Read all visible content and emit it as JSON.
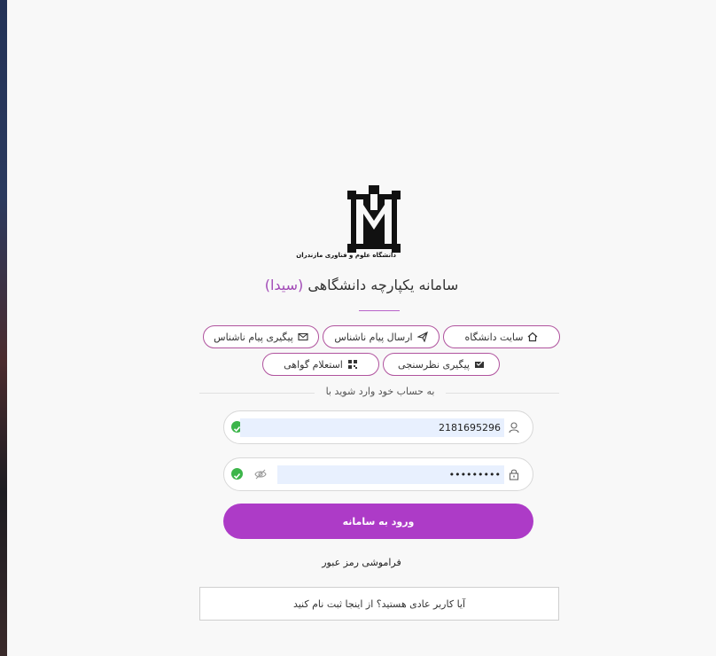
{
  "brand": {
    "logo_caption": "دانشگاه علوم و فناوری مازندران",
    "title_main": "سامانه یکپارچه دانشگاهی",
    "title_accent": "(سیدا)",
    "accent_color": "#a24bb7",
    "button_color": "#ad3bc7"
  },
  "quick_links": [
    {
      "label": "سایت دانشگاه",
      "icon": "home-icon"
    },
    {
      "label": "ارسال پیام ناشناس",
      "icon": "send-icon"
    },
    {
      "label": "پیگیری پیام ناشناس",
      "icon": "envelope-icon"
    },
    {
      "label": "پیگیری نظرسنجی",
      "icon": "inbox-icon"
    },
    {
      "label": "استعلام گواهی",
      "icon": "qr-icon"
    }
  ],
  "login": {
    "divider_text": "به حساب خود وارد شوید با",
    "username_value": "2181695296",
    "password_value": "•••••••••",
    "submit_label": "ورود به سامانه",
    "forgot_label": "فراموشی رمز عبور",
    "register_prompt": "آیا کاربر عادی هستید؟  از اینجا ثبت نام کنید"
  }
}
